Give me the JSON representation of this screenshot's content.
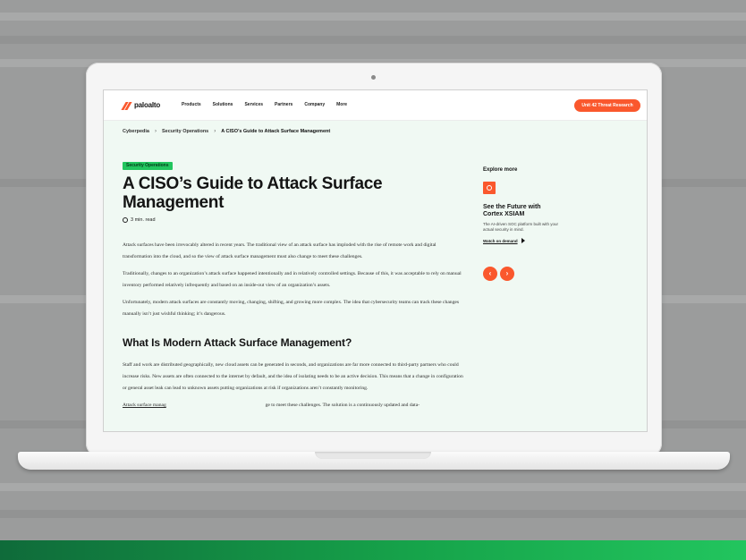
{
  "nav": {
    "logo_text": "paloalto",
    "items": [
      "Products",
      "Solutions",
      "Services",
      "Partners",
      "Company",
      "More"
    ],
    "cta_label": "Unit 42 Threat Research"
  },
  "breadcrumb": {
    "items": [
      "Cyberpedia",
      "Security Operations",
      "A CISO’s Guide to Attack Surface Management"
    ]
  },
  "article": {
    "tag": "Security Operations",
    "title": "A CISO’s Guide to Attack Surface Management",
    "read_time": "3 min. read",
    "paragraphs": [
      "Attack surfaces have been irrevocably altered in recent years. The traditional view of an attack surface has imploded with the rise of remote work and digital transformation into the cloud, and so the view of attack surface management must also change to meet these challenges.",
      "Traditionally, changes to an organization’s attack surface happened intentionally and in relatively controlled settings. Because of this, it was acceptable to rely on manual inventory performed relatively infrequently and based on an inside-out view of an organization’s assets.",
      "Unfortunately, modern attack surfaces are constantly moving, changing, shifting, and growing more complex. The idea that cybersecurity teams can track these changes manually isn’t just wishful thinking; it’s dangerous."
    ],
    "heading": "What Is Modern Attack Surface Management?",
    "paragraphs2": [
      "Staff and work are distributed geographically, new cloud assets can be generated in seconds, and organizations are far more connected to third-party partners who could increase risks. New assets are often connected to the internet by default, and the idea of isolating needs to be an active decision. This means that a change in configuration or general asset leak can lead to unknown assets putting organizations at risk if organizations aren’t constantly monitoring."
    ],
    "last_line_link": "Attack surface manag",
    "last_line_rest": "ge to meet these challenges. The solution is a continuously updated and data-"
  },
  "sidebar": {
    "heading": "Explore more",
    "promo_title": "See the Future with Cortex XSIAM",
    "promo_desc": "The AI-driven SOC platform built with your actual security in mind.",
    "promo_link": "Watch on demand",
    "prev_arrow": "‹",
    "next_arrow": "›"
  },
  "colors": {
    "accent": "#fa582d",
    "tag_green": "#22c55e",
    "page_bg": "#f0f9f3"
  }
}
